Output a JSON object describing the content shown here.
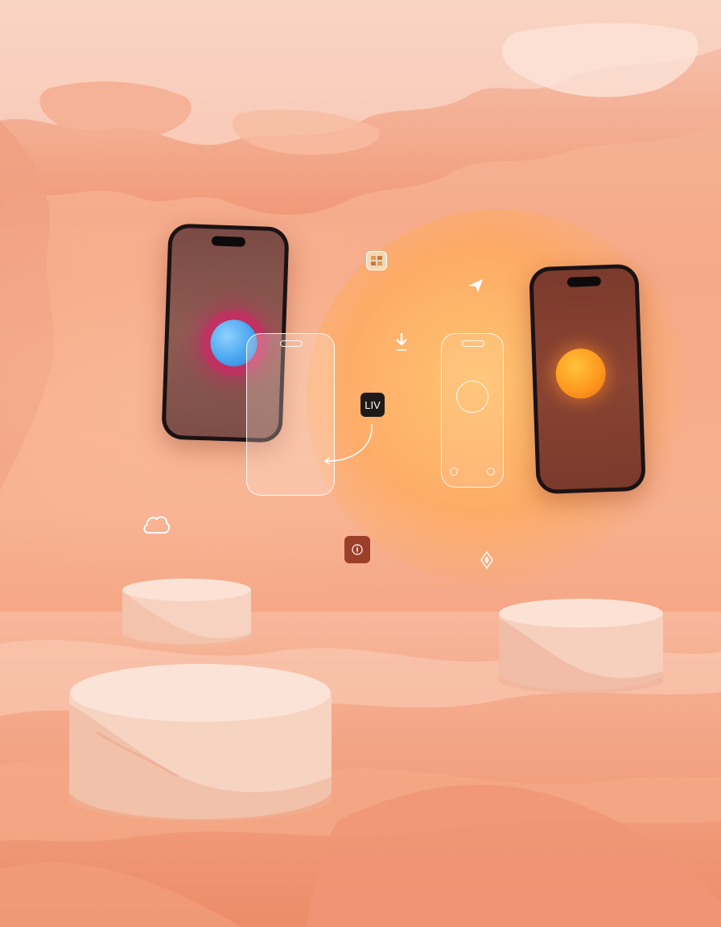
{
  "scene": {
    "colors": {
      "wall": "#f6a987",
      "glow": "#ffc46e",
      "stone": "#f7d2c0",
      "floor": "#ee9270"
    }
  },
  "phones": {
    "left": {
      "orb_color": "#4aa6f0",
      "halo_color": "#e61e6e"
    },
    "right": {
      "orb_color": "#ff9a1f"
    }
  },
  "icons": {
    "app_badge_text": "LIV",
    "gallery_icon": "gallery-icon",
    "send_icon": "paper-plane-icon",
    "download_icon": "download-icon",
    "cloud_icon": "cloud-icon",
    "compass_icon": "compass-icon",
    "diamond_icon": "diamond-icon"
  }
}
